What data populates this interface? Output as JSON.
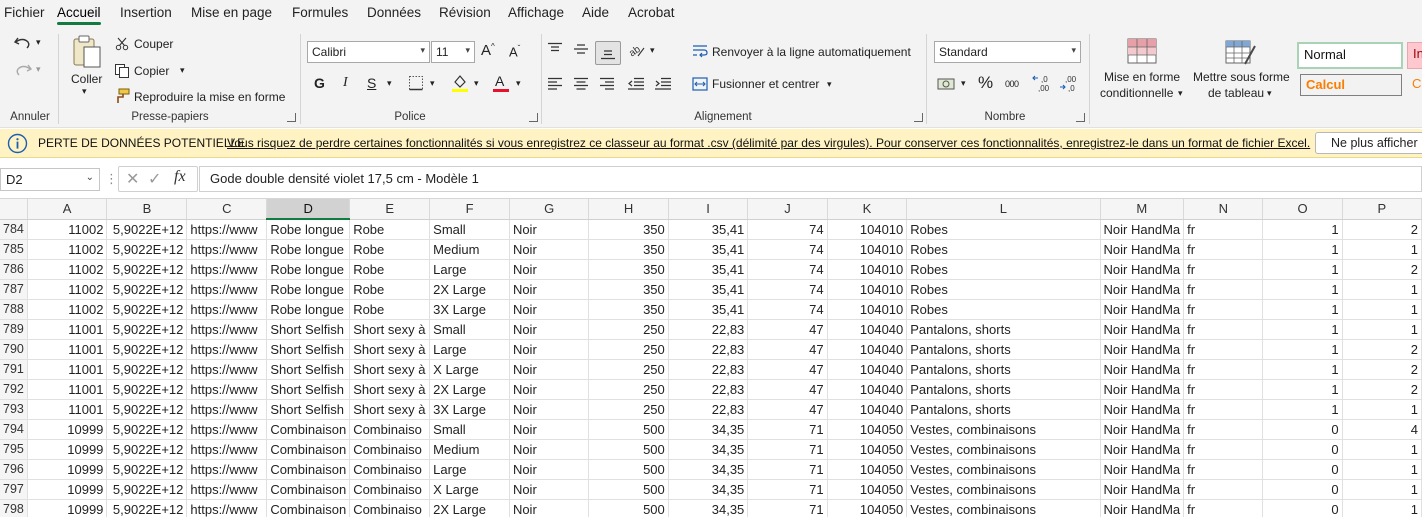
{
  "menu": {
    "tabs": [
      "Fichier",
      "Accueil",
      "Insertion",
      "Mise en page",
      "Formules",
      "Données",
      "Révision",
      "Affichage",
      "Aide",
      "Acrobat"
    ],
    "active": "Accueil"
  },
  "ribbon": {
    "annuler": {
      "label": "Annuler"
    },
    "clipboard": {
      "label": "Presse-papiers",
      "paste": "Coller",
      "cut": "Couper",
      "copy": "Copier",
      "format_painter": "Reproduire la mise en forme"
    },
    "font": {
      "label": "Police",
      "name": "Calibri",
      "size": "11",
      "bold": "G",
      "italic": "I",
      "underline": "S"
    },
    "alignment": {
      "label": "Alignement",
      "wrap": "Renvoyer à la ligne automatiquement",
      "merge": "Fusionner et centrer"
    },
    "number": {
      "label": "Nombre",
      "format": "Standard"
    },
    "styles": {
      "conditional": [
        "Mise en forme",
        "conditionnelle"
      ],
      "as_table": [
        "Mettre sous forme",
        "de tableau"
      ],
      "normal": "Normal",
      "calcul": "Calcul",
      "insuf": "In",
      "ce": "Ce"
    }
  },
  "infobar": {
    "title": "PERTE DE DONNÉES POTENTIELLE",
    "message": "Vous risquez de perdre certaines fonctionnalités si vous enregistrez ce classeur au format .csv (délimité par des virgules). Pour conserver ces fonctionnalités, enregistrez-le dans un format de fichier Excel.",
    "button": "Ne plus afficher"
  },
  "formula_bar": {
    "name_box": "D2",
    "content": "Gode double densité violet 17,5 cm - Modèle 1"
  },
  "grid": {
    "columns": [
      "A",
      "B",
      "C",
      "D",
      "E",
      "F",
      "G",
      "H",
      "I",
      "J",
      "K",
      "L",
      "M",
      "N",
      "O",
      "P"
    ],
    "selected_column": "D",
    "rows": [
      {
        "n": "784",
        "c": [
          "11002",
          "5,9022E+12",
          "https://www",
          "Robe longue",
          "Robe",
          "Small",
          "Noir",
          "350",
          "35,41",
          "74",
          "104010",
          "Robes",
          "Noir HandMa",
          "fr",
          "1",
          "2"
        ]
      },
      {
        "n": "785",
        "c": [
          "11002",
          "5,9022E+12",
          "https://www",
          "Robe longue",
          "Robe",
          "Medium",
          "Noir",
          "350",
          "35,41",
          "74",
          "104010",
          "Robes",
          "Noir HandMa",
          "fr",
          "1",
          "1"
        ]
      },
      {
        "n": "786",
        "c": [
          "11002",
          "5,9022E+12",
          "https://www",
          "Robe longue",
          "Robe",
          "Large",
          "Noir",
          "350",
          "35,41",
          "74",
          "104010",
          "Robes",
          "Noir HandMa",
          "fr",
          "1",
          "2"
        ]
      },
      {
        "n": "787",
        "c": [
          "11002",
          "5,9022E+12",
          "https://www",
          "Robe longue",
          "Robe",
          "2X Large",
          "Noir",
          "350",
          "35,41",
          "74",
          "104010",
          "Robes",
          "Noir HandMa",
          "fr",
          "1",
          "1"
        ]
      },
      {
        "n": "788",
        "c": [
          "11002",
          "5,9022E+12",
          "https://www",
          "Robe longue",
          "Robe",
          "3X Large",
          "Noir",
          "350",
          "35,41",
          "74",
          "104010",
          "Robes",
          "Noir HandMa",
          "fr",
          "1",
          "1"
        ]
      },
      {
        "n": "789",
        "c": [
          "11001",
          "5,9022E+12",
          "https://www",
          "Short Selfish",
          "Short sexy à",
          "Small",
          "Noir",
          "250",
          "22,83",
          "47",
          "104040",
          "Pantalons, shorts",
          "Noir HandMa",
          "fr",
          "1",
          "1"
        ]
      },
      {
        "n": "790",
        "c": [
          "11001",
          "5,9022E+12",
          "https://www",
          "Short Selfish",
          "Short sexy à",
          "Large",
          "Noir",
          "250",
          "22,83",
          "47",
          "104040",
          "Pantalons, shorts",
          "Noir HandMa",
          "fr",
          "1",
          "2"
        ]
      },
      {
        "n": "791",
        "c": [
          "11001",
          "5,9022E+12",
          "https://www",
          "Short Selfish",
          "Short sexy à",
          "X Large",
          "Noir",
          "250",
          "22,83",
          "47",
          "104040",
          "Pantalons, shorts",
          "Noir HandMa",
          "fr",
          "1",
          "2"
        ]
      },
      {
        "n": "792",
        "c": [
          "11001",
          "5,9022E+12",
          "https://www",
          "Short Selfish",
          "Short sexy à",
          "2X Large",
          "Noir",
          "250",
          "22,83",
          "47",
          "104040",
          "Pantalons, shorts",
          "Noir HandMa",
          "fr",
          "1",
          "2"
        ]
      },
      {
        "n": "793",
        "c": [
          "11001",
          "5,9022E+12",
          "https://www",
          "Short Selfish",
          "Short sexy à",
          "3X Large",
          "Noir",
          "250",
          "22,83",
          "47",
          "104040",
          "Pantalons, shorts",
          "Noir HandMa",
          "fr",
          "1",
          "1"
        ]
      },
      {
        "n": "794",
        "c": [
          "10999",
          "5,9022E+12",
          "https://www",
          "Combinaison",
          "Combinaiso",
          "Small",
          "Noir",
          "500",
          "34,35",
          "71",
          "104050",
          "Vestes, combinaisons",
          "Noir HandMa",
          "fr",
          "0",
          "4"
        ]
      },
      {
        "n": "795",
        "c": [
          "10999",
          "5,9022E+12",
          "https://www",
          "Combinaison",
          "Combinaiso",
          "Medium",
          "Noir",
          "500",
          "34,35",
          "71",
          "104050",
          "Vestes, combinaisons",
          "Noir HandMa",
          "fr",
          "0",
          "1"
        ]
      },
      {
        "n": "796",
        "c": [
          "10999",
          "5,9022E+12",
          "https://www",
          "Combinaison",
          "Combinaiso",
          "Large",
          "Noir",
          "500",
          "34,35",
          "71",
          "104050",
          "Vestes, combinaisons",
          "Noir HandMa",
          "fr",
          "0",
          "1"
        ]
      },
      {
        "n": "797",
        "c": [
          "10999",
          "5,9022E+12",
          "https://www",
          "Combinaison",
          "Combinaiso",
          "X Large",
          "Noir",
          "500",
          "34,35",
          "71",
          "104050",
          "Vestes, combinaisons",
          "Noir HandMa",
          "fr",
          "0",
          "1"
        ]
      },
      {
        "n": "798",
        "c": [
          "10999",
          "5,9022E+12",
          "https://www",
          "Combinaison",
          "Combinaiso",
          "2X Large",
          "Noir",
          "500",
          "34,35",
          "71",
          "104050",
          "Vestes, combinaisons",
          "Noir HandMa",
          "fr",
          "0",
          "1"
        ]
      }
    ],
    "numeric_columns": [
      0,
      1,
      7,
      8,
      9,
      10,
      14,
      15
    ]
  }
}
